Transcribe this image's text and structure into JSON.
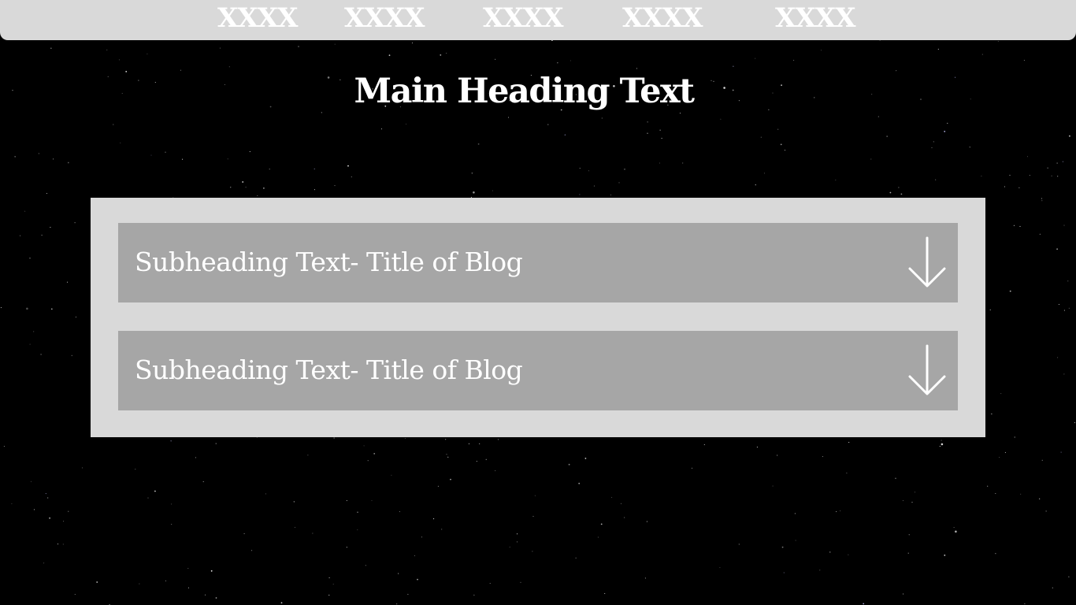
{
  "nav": {
    "items": [
      {
        "label": "XXXX"
      },
      {
        "label": "XXXX"
      },
      {
        "label": "XXXX"
      },
      {
        "label": "XXXX"
      },
      {
        "label": "XXXX"
      }
    ]
  },
  "main": {
    "heading": "Main Heading Text",
    "accordion": [
      {
        "title": "Subheading Text- Title of Blog",
        "icon": "arrow-down-icon"
      },
      {
        "title": "Subheading Text- Title of Blog",
        "icon": "arrow-down-icon"
      }
    ]
  },
  "colors": {
    "background": "#000000",
    "navbar": "#d9d9d9",
    "panel": "#d9d9d9",
    "accordion_item": "#a6a6a6",
    "text": "#ffffff"
  }
}
